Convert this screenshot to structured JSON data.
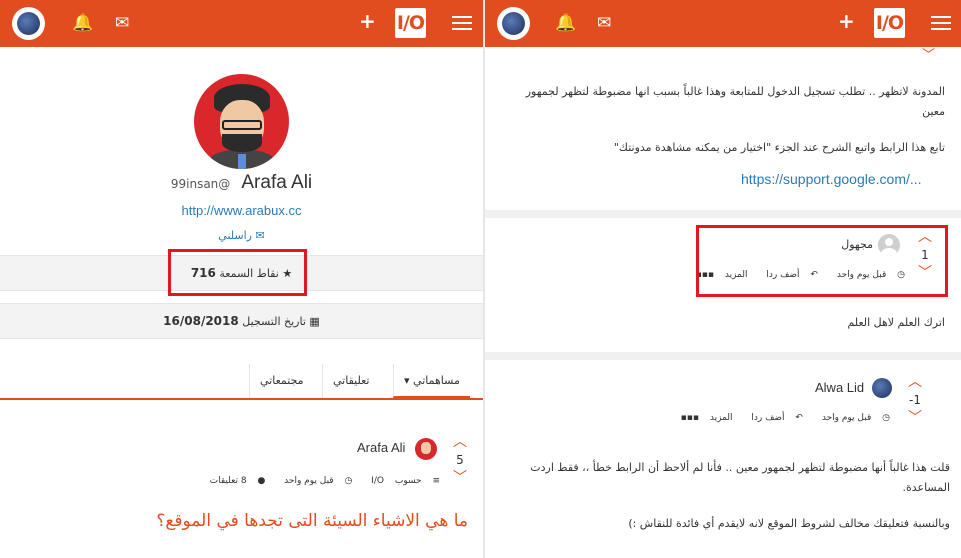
{
  "left": {
    "topbar": {
      "bell_icon": "bell-icon",
      "mail_icon": "envelope-icon",
      "plus": "+",
      "io_logo": "I/O"
    },
    "profile": {
      "full_name": "Arafa Ali",
      "username": "99insan@",
      "website": "http://www.arabux.cc",
      "contact_label": "راسلني",
      "reputation_label": "نقاط السمعة",
      "reputation_value": "716",
      "registered_label": "تاريخ التسجيل",
      "registered_value": "16/08/2018"
    },
    "tabs": [
      {
        "label": "مساهماتي"
      },
      {
        "label": "تعليقاتي"
      },
      {
        "label": "مجتمعاتي"
      }
    ],
    "post": {
      "author": "Arafa Ali",
      "votes": "5",
      "comments": "8 تعليقات",
      "time": "قبل يوم واحد",
      "category": "I/O",
      "account_label": "حسوب",
      "title": "ما هي الاشياء السيئة التى تجدها في الموقع؟"
    }
  },
  "right": {
    "text_block": {
      "line1": "المدونة لاتظهر .. تطلب تسجيل الدخول للمتابعة وهذا غالباً بسبب انها مضبوطة لتظهر لجمهور معين",
      "line2": "تابع هذا الرابط واتبع الشرح عند الجزء \"اختيار من يمكنه مشاهدة مدونتك\"",
      "link": "https://support.google.com/..."
    },
    "comment1": {
      "author": "مجهول",
      "votes": "1",
      "time": "قبل يوم واحد",
      "reply": "أضف ردا",
      "more": "المزيد",
      "body": "اترك العلم لاهل العلم"
    },
    "comment2": {
      "author": "Alwa Lid",
      "votes": "-1",
      "time": "قبل يوم واحد",
      "reply": "أضف ردا",
      "more": "المزيد",
      "body1": "قلت هذا غالباً أنها مضبوطة لتظهر لجمهور معين .. فأنا لم ألاحظ أن الرابط خطأ ،، فقط اردت المساعدة.",
      "body2": "وبالنسبة فتعليقك مخالف لشروط الموقع لانه لايقدم أي فائدة للنقاش :)"
    }
  },
  "colors": {
    "accent": "#e14d1f",
    "link": "#2a7ab8",
    "highlight": "#e0191e"
  }
}
